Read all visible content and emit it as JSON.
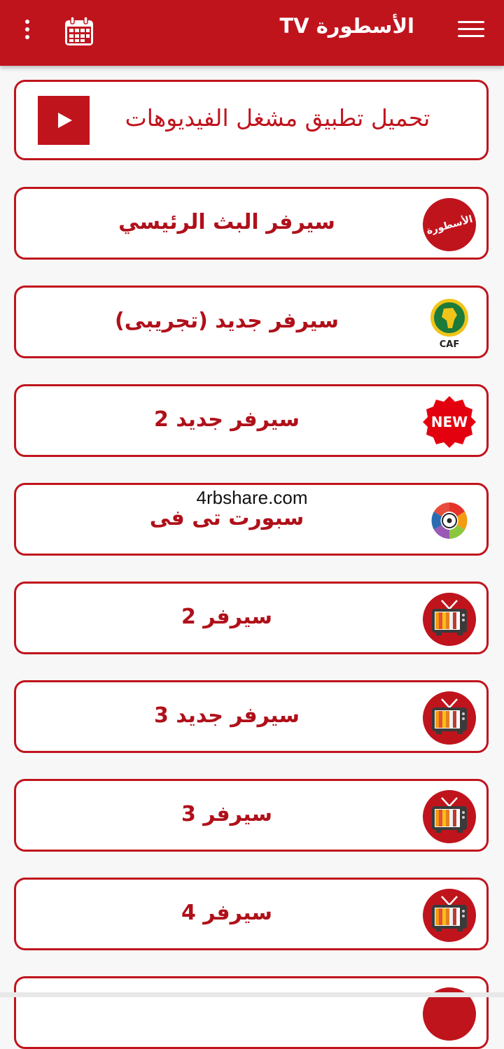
{
  "appbar": {
    "title": "الأسطورة TV",
    "menu_icon": "menu-icon",
    "calendar_icon": "calendar-icon",
    "more_icon": "more-vert-icon",
    "color": "#c0141d"
  },
  "download": {
    "label": "تحميل تطبيق مشغل الفيديوهات",
    "icon": "play-icon"
  },
  "watermark": "4rbshare.com",
  "servers": [
    {
      "label": "سيرفر البث الرئيسي",
      "icon": "ostora-logo-icon",
      "badge_text": "الأسطورة"
    },
    {
      "label": "سيرفر جديد (تجريبى)",
      "icon": "caf-logo-icon",
      "badge_text": "CAF"
    },
    {
      "label": "سيرفر جديد 2",
      "icon": "new-badge-icon",
      "badge_text": "NEW"
    },
    {
      "label": "سبورت تى فى",
      "icon": "laliga-logo-icon"
    },
    {
      "label": "سيرفر 2",
      "icon": "tv-icon"
    },
    {
      "label": "سيرفر جديد 3",
      "icon": "tv-icon"
    },
    {
      "label": "سيرفر 3",
      "icon": "tv-icon"
    },
    {
      "label": "سيرفر 4",
      "icon": "tv-icon"
    },
    {
      "label": "",
      "icon": "tv-icon"
    }
  ]
}
